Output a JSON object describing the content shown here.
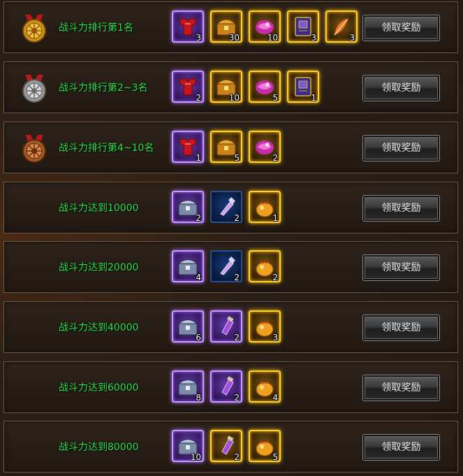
{
  "rewards": [
    {
      "title": "战斗力排行第1名",
      "medal": "gold-medal-icon",
      "button": "领取奖励",
      "items": [
        {
          "icon": "red-armor-icon",
          "rarity": "purple",
          "count": "3"
        },
        {
          "icon": "treasure-chest-icon",
          "rarity": "gold",
          "count": "30"
        },
        {
          "icon": "pink-orb-icon",
          "rarity": "gold",
          "count": "10"
        },
        {
          "icon": "spell-book-icon",
          "rarity": "gold",
          "count": "3"
        },
        {
          "icon": "feather-icon",
          "rarity": "gold",
          "count": "3"
        }
      ]
    },
    {
      "title": "战斗力排行第2~3名",
      "medal": "silver-medal-icon",
      "button": "领取奖励",
      "items": [
        {
          "icon": "red-armor-icon",
          "rarity": "purple",
          "count": "2"
        },
        {
          "icon": "treasure-chest-icon",
          "rarity": "gold",
          "count": "10"
        },
        {
          "icon": "pink-orb-icon",
          "rarity": "gold",
          "count": "5"
        },
        {
          "icon": "spell-book-icon",
          "rarity": "gold",
          "count": "1"
        }
      ]
    },
    {
      "title": "战斗力排行第4~10名",
      "medal": "bronze-medal-icon",
      "button": "领取奖励",
      "items": [
        {
          "icon": "red-armor-icon",
          "rarity": "purple",
          "count": "1"
        },
        {
          "icon": "treasure-chest-icon",
          "rarity": "gold",
          "count": "5"
        },
        {
          "icon": "pink-orb-icon",
          "rarity": "gold",
          "count": "2"
        }
      ]
    },
    {
      "title": "战斗力达到10000",
      "button": "领取奖励",
      "items": [
        {
          "icon": "silver-chest-icon",
          "rarity": "purple",
          "count": "2"
        },
        {
          "icon": "potion-tube-icon",
          "rarity": "blue",
          "count": "2"
        },
        {
          "icon": "gold-pouch-icon",
          "rarity": "gold",
          "count": "1"
        }
      ]
    },
    {
      "title": "战斗力达到20000",
      "button": "领取奖励",
      "items": [
        {
          "icon": "silver-chest-icon",
          "rarity": "purple",
          "count": "4"
        },
        {
          "icon": "potion-tube-icon",
          "rarity": "blue",
          "count": "2"
        },
        {
          "icon": "gold-pouch-icon",
          "rarity": "gold",
          "count": "2"
        }
      ]
    },
    {
      "title": "战斗力达到40000",
      "button": "领取奖励",
      "items": [
        {
          "icon": "silver-chest-icon",
          "rarity": "purple",
          "count": "6"
        },
        {
          "icon": "potion-bottle-icon",
          "rarity": "purple",
          "count": "2"
        },
        {
          "icon": "gold-pouch-icon",
          "rarity": "gold",
          "count": "3"
        }
      ]
    },
    {
      "title": "战斗力达到60000",
      "button": "领取奖励",
      "items": [
        {
          "icon": "silver-chest-icon",
          "rarity": "purple",
          "count": "8"
        },
        {
          "icon": "potion-bottle-icon",
          "rarity": "purple",
          "count": "2"
        },
        {
          "icon": "gold-pouch-icon",
          "rarity": "gold",
          "count": "4"
        }
      ]
    },
    {
      "title": "战斗力达到80000",
      "button": "领取奖励",
      "items": [
        {
          "icon": "silver-chest-icon",
          "rarity": "purple",
          "count": "10"
        },
        {
          "icon": "potion-bottle-icon",
          "rarity": "gold",
          "count": "2"
        },
        {
          "icon": "gold-pouch-icon",
          "rarity": "gold",
          "count": "5"
        }
      ]
    }
  ],
  "colors": {
    "title_green": "#2ee64a",
    "gold_frame": "#ffd23a",
    "purple_frame": "#c79bff",
    "blue_frame": "#2a4f90"
  }
}
